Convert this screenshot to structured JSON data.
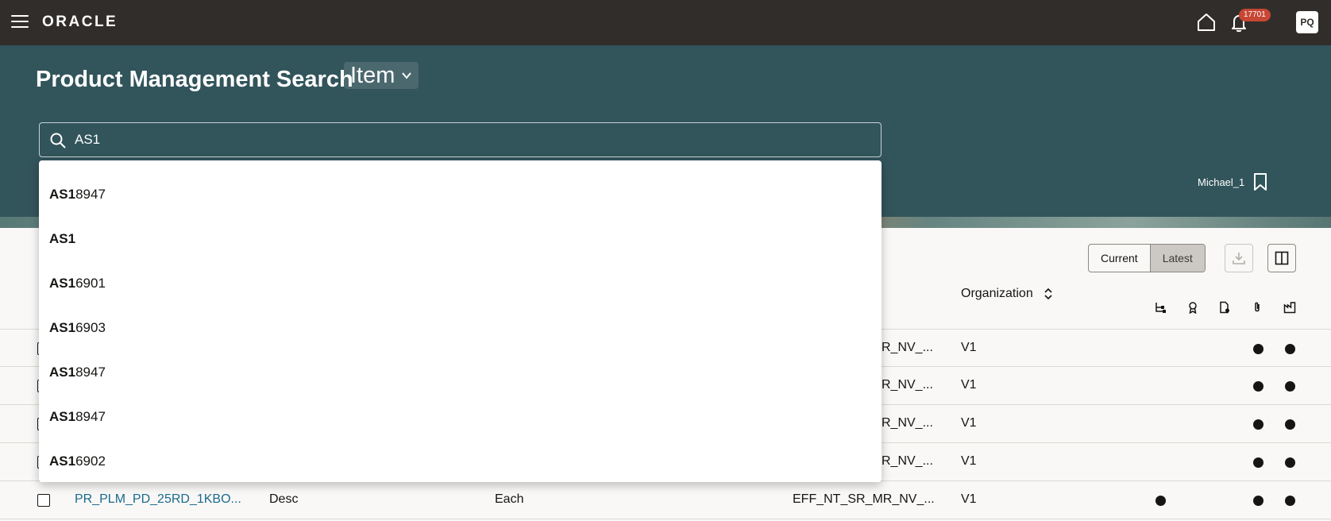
{
  "topbar": {
    "logo": "ORACLE",
    "notification_count": "17701",
    "avatar_initials": "PQ"
  },
  "header": {
    "title": "Product Management Search",
    "scope": "Item",
    "saved_search_name": "Michael_1"
  },
  "search": {
    "value": "AS1",
    "suggestions": [
      {
        "match": "AS1",
        "rest": "8947"
      },
      {
        "match": "AS1",
        "rest": ""
      },
      {
        "match": "AS1",
        "rest": "6901"
      },
      {
        "match": "AS1",
        "rest": "6903"
      },
      {
        "match": "AS1",
        "rest": "8947"
      },
      {
        "match": "AS1",
        "rest": "8947"
      },
      {
        "match": "AS1",
        "rest": "6902"
      }
    ]
  },
  "toolbar": {
    "current_label": "Current",
    "latest_label": "Latest"
  },
  "table": {
    "organization_header": "Organization",
    "rows": [
      {
        "item": "",
        "description": "",
        "uom": "",
        "structure": "R_NV_...",
        "org": "V1",
        "dots": [
          false,
          false,
          false,
          true,
          true
        ]
      },
      {
        "item": "",
        "description": "",
        "uom": "",
        "structure": "R_NV_...",
        "org": "V1",
        "dots": [
          false,
          false,
          false,
          true,
          true
        ]
      },
      {
        "item": "",
        "description": "",
        "uom": "",
        "structure": "R_NV_...",
        "org": "V1",
        "dots": [
          false,
          false,
          false,
          true,
          true
        ]
      },
      {
        "item": "",
        "description": "",
        "uom": "",
        "structure": "R_NV_...",
        "org": "V1",
        "dots": [
          false,
          false,
          false,
          true,
          true
        ]
      },
      {
        "item": "PR_PLM_PD_25RD_1KBO...",
        "description": "Desc",
        "uom": "Each",
        "structure": "EFF_NT_SR_MR_NV_...",
        "org": "V1",
        "dots": [
          true,
          false,
          false,
          true,
          true
        ]
      }
    ]
  }
}
